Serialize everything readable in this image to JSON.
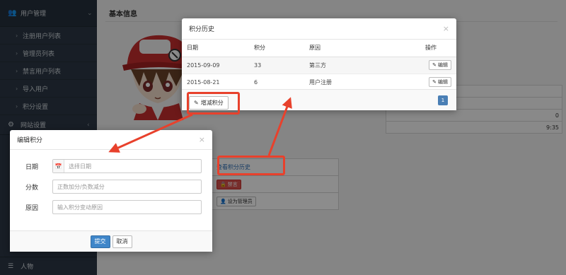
{
  "sidebar": {
    "group_user": {
      "label": "用户管理"
    },
    "items": [
      {
        "label": "注册用户列表"
      },
      {
        "label": "管理员列表"
      },
      {
        "label": "禁言用户列表"
      },
      {
        "label": "导入用户"
      },
      {
        "label": "积分设置"
      }
    ],
    "group_site": {
      "label": "网站设置"
    },
    "bottom": {
      "label": "人物"
    }
  },
  "main": {
    "title": "基本信息",
    "detail_values": [
      "",
      "",
      "0",
      "9:35"
    ],
    "ops": {
      "view_history": "查看积分历史",
      "ban": "禁言",
      "set_admin": "设为管理员"
    }
  },
  "history_modal": {
    "title": "积分历史",
    "close": "×",
    "columns": [
      "日期",
      "积分",
      "原因",
      "操作"
    ],
    "rows": [
      {
        "date": "2015-09-09",
        "points": "33",
        "reason": "第三方",
        "action": "编辑"
      },
      {
        "date": "2015-08-21",
        "points": "6",
        "reason": "用户注册",
        "action": "编辑"
      }
    ],
    "add_button": "增减积分",
    "page": "1"
  },
  "edit_modal": {
    "title": "编辑积分",
    "close": "×",
    "date_label": "日期",
    "date_placeholder": "选择日期",
    "points_label": "分数",
    "points_placeholder": "正数加分/负数减分",
    "reason_label": "原因",
    "reason_placeholder": "输入积分变动原因",
    "submit": "提交",
    "cancel": "取消"
  },
  "colors": {
    "sidebar_bg": "#2c3845",
    "primary": "#3f86c9",
    "danger": "#d9534f",
    "annotation": "#e8412c"
  }
}
